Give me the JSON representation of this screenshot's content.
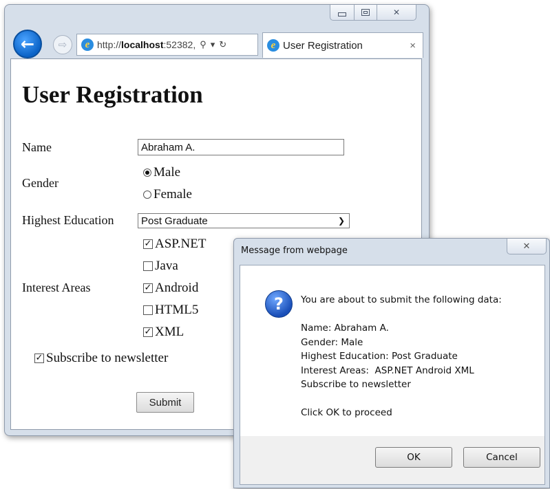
{
  "browser": {
    "address": {
      "prefix": "http://",
      "host": "localhost",
      "rest": ":52382,",
      "search_glyph": "⚲",
      "dropdown_glyph": "▾",
      "refresh_glyph": "↻"
    },
    "tab": {
      "title": "User Registration",
      "close_glyph": "×"
    },
    "caption": {
      "close_glyph": "✕"
    }
  },
  "form": {
    "title": "User Registration",
    "name_label": "Name",
    "name_value": "Abraham A.",
    "gender_label": "Gender",
    "gender_options": [
      {
        "label": "Male",
        "selected": true
      },
      {
        "label": "Female",
        "selected": false
      }
    ],
    "education_label": "Highest Education",
    "education_value": "Post Graduate",
    "interest_label": "Interest Areas",
    "interests": [
      {
        "label": "ASP.NET",
        "checked": true
      },
      {
        "label": "Java",
        "checked": false
      },
      {
        "label": "Android",
        "checked": true
      },
      {
        "label": "HTML5",
        "checked": false
      },
      {
        "label": "XML",
        "checked": true
      }
    ],
    "subscribe_label": "Subscribe to newsletter",
    "subscribe_checked": true,
    "submit_label": "Submit"
  },
  "dialog": {
    "title": "Message from webpage",
    "close_glyph": "✕",
    "icon": "question-icon",
    "lines": [
      "You are about to submit the following data:",
      "",
      "Name: Abraham A.",
      "Gender: Male",
      "Highest Education: Post Graduate",
      "Interest Areas:  ASP.NET Android XML",
      "Subscribe to newsletter",
      "",
      "Click OK to proceed"
    ],
    "ok_label": "OK",
    "cancel_label": "Cancel"
  },
  "colors": {
    "back_button": "#0b63c7",
    "ie_icon": "#2a8de0",
    "question_icon": "#1a4fb8"
  }
}
